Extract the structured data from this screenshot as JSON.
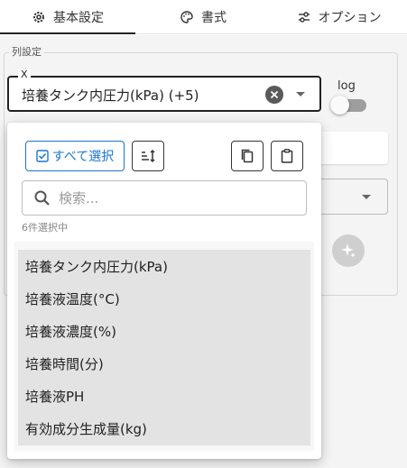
{
  "tabs": [
    {
      "label": "基本設定",
      "icon": "gear-icon"
    },
    {
      "label": "書式",
      "icon": "palette-icon"
    },
    {
      "label": "オプション",
      "icon": "sliders-icon"
    }
  ],
  "section": {
    "legend": "列設定"
  },
  "x_field": {
    "label": "X",
    "value": "培養タンク内圧力(kPa) (+5)"
  },
  "log_toggle": {
    "label": "log",
    "checked": false
  },
  "popup": {
    "select_all_label": "すべて選択",
    "search_placeholder": "検索...",
    "selected_count": "6件選択中",
    "items": [
      "培養タンク内圧力(kPa)",
      "培養液温度(°C)",
      "培養液濃度(%)",
      "培養時間(分)",
      "培養液PH",
      "有効成分生成量(kg)"
    ]
  },
  "colors": {
    "accent": "#1976d2",
    "selected_bg": "#e3e3e3"
  }
}
